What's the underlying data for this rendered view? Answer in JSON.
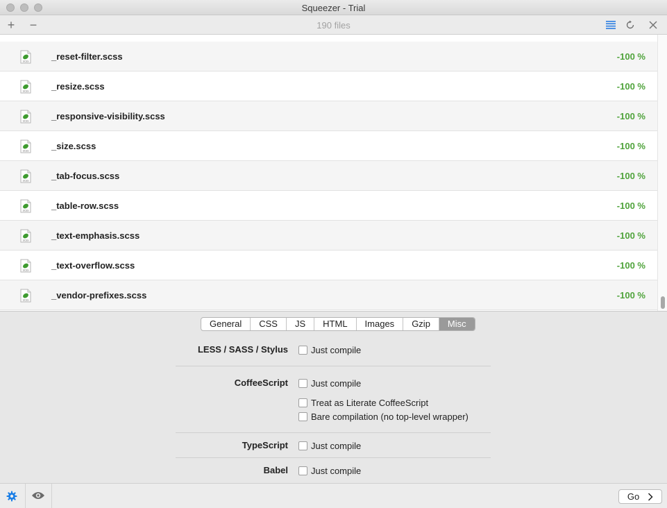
{
  "window": {
    "title": "Squeezer - Trial"
  },
  "toolbar": {
    "file_count": "190 files",
    "add_label": "+",
    "remove_label": "−"
  },
  "files": [
    {
      "name": "_reset-filter.scss",
      "percent": "-100 %"
    },
    {
      "name": "_resize.scss",
      "percent": "-100 %"
    },
    {
      "name": "_responsive-visibility.scss",
      "percent": "-100 %"
    },
    {
      "name": "_size.scss",
      "percent": "-100 %"
    },
    {
      "name": "_tab-focus.scss",
      "percent": "-100 %"
    },
    {
      "name": "_table-row.scss",
      "percent": "-100 %"
    },
    {
      "name": "_text-emphasis.scss",
      "percent": "-100 %"
    },
    {
      "name": "_text-overflow.scss",
      "percent": "-100 %"
    },
    {
      "name": "_vendor-prefixes.scss",
      "percent": "-100 %"
    }
  ],
  "tabs": [
    {
      "label": "General",
      "active": false
    },
    {
      "label": "CSS",
      "active": false
    },
    {
      "label": "JS",
      "active": false
    },
    {
      "label": "HTML",
      "active": false
    },
    {
      "label": "Images",
      "active": false
    },
    {
      "label": "Gzip",
      "active": false
    },
    {
      "label": "Misc",
      "active": true
    }
  ],
  "options": {
    "less_sass_stylus": {
      "label": "LESS / SASS / Stylus",
      "just_compile": "Just compile"
    },
    "coffeescript": {
      "label": "CoffeeScript",
      "just_compile": "Just compile",
      "literate": "Treat as Literate CoffeeScript",
      "bare": "Bare compilation (no top-level wrapper)"
    },
    "typescript": {
      "label": "TypeScript",
      "just_compile": "Just compile"
    },
    "babel": {
      "label": "Babel",
      "just_compile": "Just compile"
    }
  },
  "footer": {
    "go_label": "Go"
  },
  "colors": {
    "percent": "#4fa33b",
    "settings_icon": "#1a7ee6",
    "active_tab": "#9a9a9a"
  },
  "icons": [
    "settings-gear-icon",
    "eye-icon",
    "list-view-icon",
    "refresh-icon",
    "close-icon",
    "chevron-right-icon",
    "scss-file-icon"
  ]
}
